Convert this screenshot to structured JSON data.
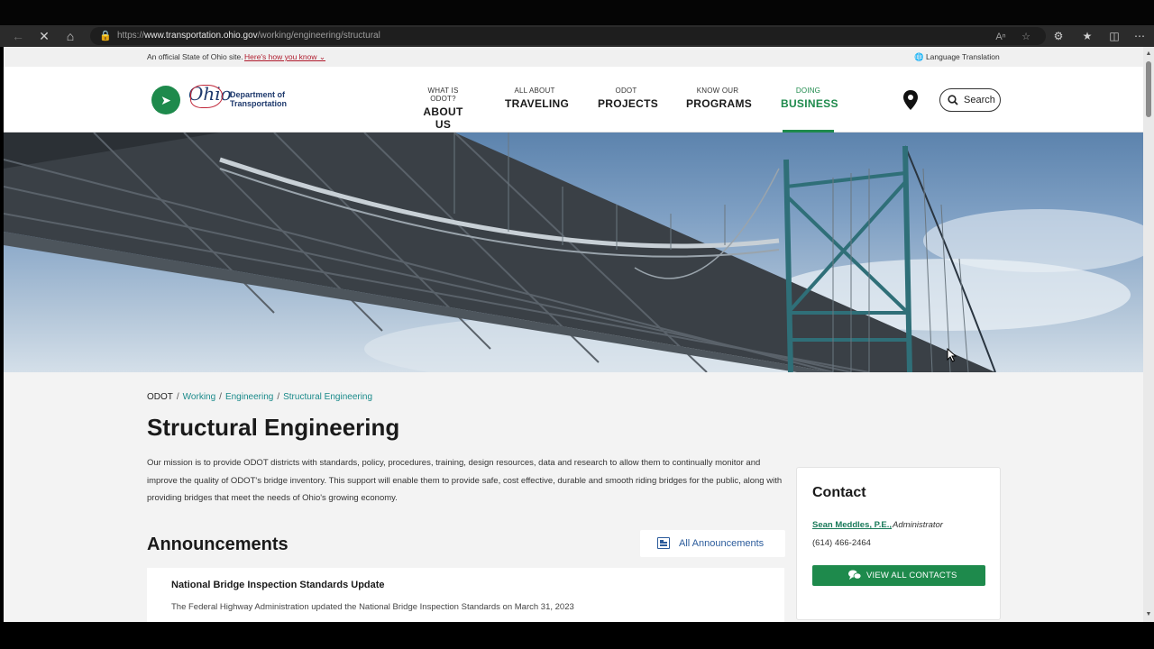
{
  "browser": {
    "url_prefix": "https://",
    "url_host": "www.transportation.ohio.gov",
    "url_path": "/working/engineering/structural"
  },
  "official_bar": {
    "text": "An official State of Ohio site.",
    "link": "Here's how you know",
    "language": "Language Translation"
  },
  "logo": {
    "mark": "Ohio",
    "dept_line1": "Department of",
    "dept_line2": "Transportation"
  },
  "nav": [
    {
      "small": "WHAT IS ODOT?",
      "big": "ABOUT US"
    },
    {
      "small": "ALL ABOUT",
      "big": "TRAVELING"
    },
    {
      "small": "ODOT",
      "big": "PROJECTS"
    },
    {
      "small": "KNOW OUR",
      "big": "PROGRAMS"
    },
    {
      "small": "DOING",
      "big": "BUSINESS"
    }
  ],
  "search": {
    "label": "Search"
  },
  "breadcrumb": {
    "root": "ODOT",
    "items": [
      "Working",
      "Engineering",
      "Structural Engineering"
    ]
  },
  "page": {
    "title": "Structural Engineering",
    "mission": "Our mission is to provide ODOT districts with standards, policy, procedures, training, design resources, data and research to allow them to continually monitor and improve the quality of ODOT's bridge inventory. This support will enable them to provide safe, cost effective, durable and smooth riding bridges for the public, along with providing bridges that meet the needs of Ohio's growing economy."
  },
  "announcements": {
    "heading": "Announcements",
    "all_label": "All Announcements",
    "items": [
      {
        "title": "National Bridge Inspection Standards Update",
        "desc": "The Federal Highway Administration updated the National Bridge Inspection Standards on March 31, 2023"
      }
    ]
  },
  "contact": {
    "heading": "Contact",
    "name": "Sean Meddles, P.E.,",
    "role": "Administrator",
    "phone": "(614) 466-2464",
    "button": "VIEW ALL CONTACTS"
  },
  "colors": {
    "brand_green": "#1e8a4c",
    "link_teal": "#1a8a8a",
    "alert_red": "#b01c2e"
  }
}
